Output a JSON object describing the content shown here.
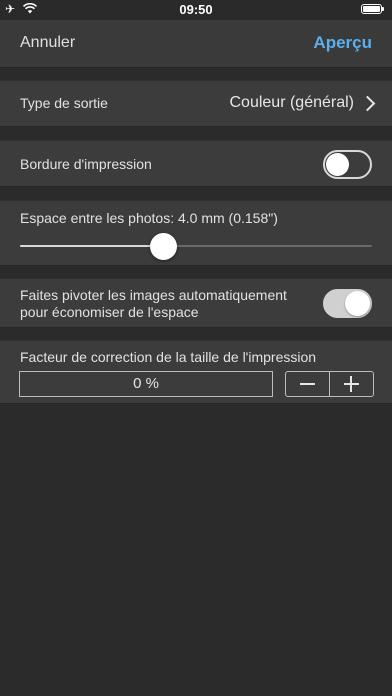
{
  "status_bar": {
    "time": "09:50",
    "icons": [
      "airplane-icon",
      "wifi-icon",
      "battery-icon"
    ]
  },
  "navbar": {
    "cancel_label": "Annuler",
    "preview_label": "Aperçu",
    "accent_color": "#5ab0ee"
  },
  "output_type": {
    "label": "Type de sortie",
    "value": "Couleur (général)"
  },
  "print_border": {
    "label": "Bordure d'impression",
    "enabled": false
  },
  "photo_spacing": {
    "label": "Espace entre les photos: 4.0 mm (0.158\")",
    "fraction": 0.41
  },
  "auto_rotate": {
    "label_line1": "Faites pivoter les images automatiquement",
    "label_line2": "pour économiser de l'espace",
    "enabled": true
  },
  "size_correction": {
    "label": "Facteur de correction de la taille de l'impression",
    "value": "0 %",
    "decrement_symbol": "−",
    "increment_symbol": "+"
  }
}
